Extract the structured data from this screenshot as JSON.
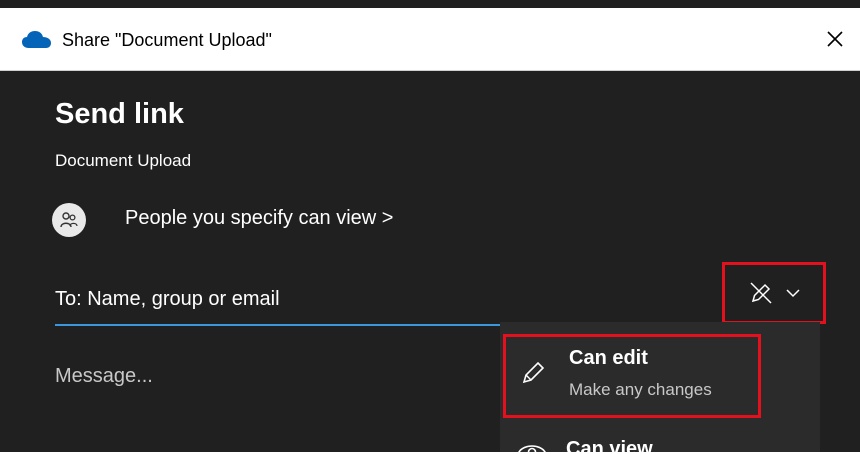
{
  "window": {
    "title": "Share \"Document Upload\"",
    "close_label": "×"
  },
  "dialog": {
    "heading": "Send link",
    "document_name": "Document Upload",
    "link_settings": "People you specify can view >",
    "to_placeholder": "To: Name, group or email",
    "message_placeholder": "Message..."
  },
  "permission_menu": {
    "options": [
      {
        "title": "Can edit",
        "subtitle": "Make any changes",
        "icon": "pencil-icon"
      },
      {
        "title": "Can view",
        "icon": "eye-icon"
      }
    ]
  },
  "colors": {
    "background": "#202020",
    "dropdown": "#2b2b2b",
    "accent": "#3a96dd",
    "highlight": "#e3101e",
    "cloud": "#0364b8"
  }
}
